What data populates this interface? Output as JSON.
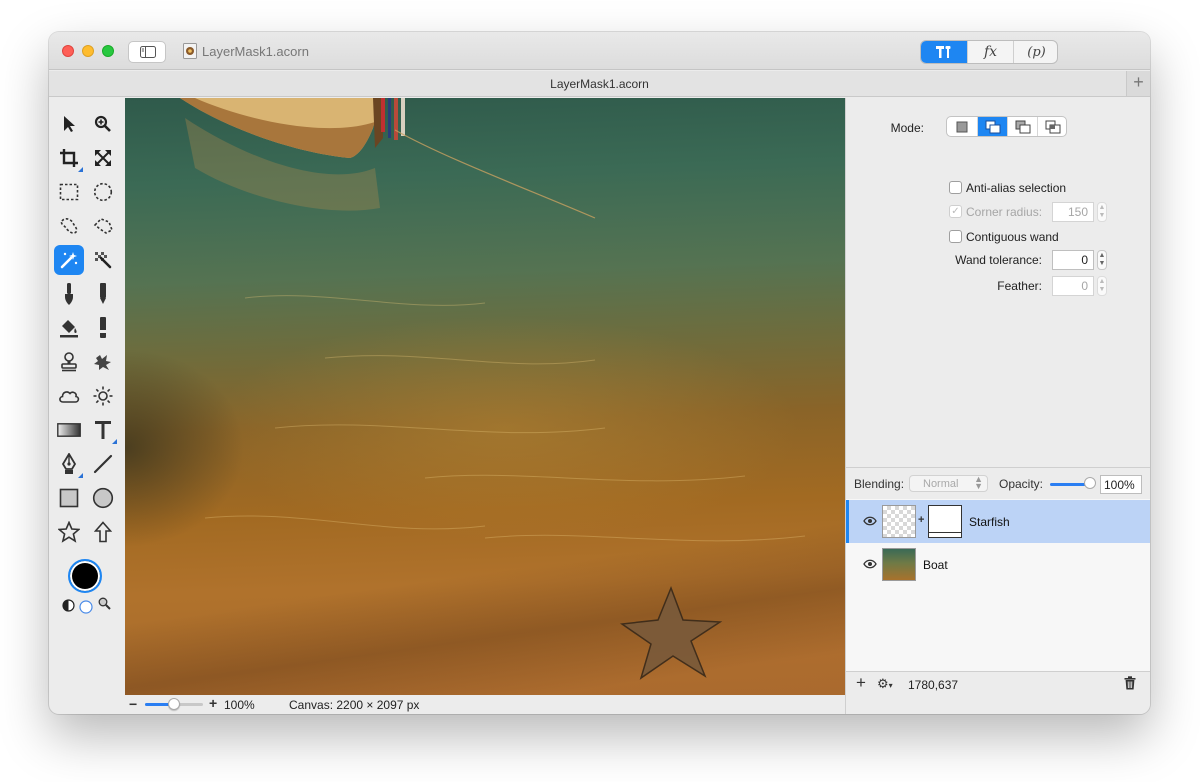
{
  "window": {
    "title": "LayerMask1.acorn",
    "tab_title": "LayerMask1.acorn",
    "tab_add_label": "+"
  },
  "toolbar": {
    "segments": [
      {
        "icon": "tools-icon",
        "selected": true
      },
      {
        "icon": "fx-icon",
        "label": "fx",
        "selected": false
      },
      {
        "icon": "p-icon",
        "label": "(p)",
        "selected": false
      }
    ]
  },
  "tools": [
    {
      "name": "select-arrow-icon"
    },
    {
      "name": "zoom-icon"
    },
    {
      "name": "crop-icon"
    },
    {
      "name": "resize-icon"
    },
    {
      "name": "rect-select-icon"
    },
    {
      "name": "ellipse-select-icon"
    },
    {
      "name": "lasso-icon"
    },
    {
      "name": "polygon-lasso-icon"
    },
    {
      "name": "magic-wand-icon",
      "active": true
    },
    {
      "name": "magic-eraser-icon"
    },
    {
      "name": "brush-icon"
    },
    {
      "name": "pencil-icon"
    },
    {
      "name": "paint-bucket-icon"
    },
    {
      "name": "eraser-icon"
    },
    {
      "name": "stamp-icon"
    },
    {
      "name": "smudge-icon"
    },
    {
      "name": "cloud-icon"
    },
    {
      "name": "sun-icon"
    },
    {
      "name": "gradient-icon"
    },
    {
      "name": "text-icon"
    },
    {
      "name": "pen-icon"
    },
    {
      "name": "line-icon"
    },
    {
      "name": "rectangle-icon"
    },
    {
      "name": "circle-icon"
    },
    {
      "name": "star-icon"
    },
    {
      "name": "arrow-up-icon"
    }
  ],
  "colors": {
    "foreground": "#000000",
    "background": "#ffffff",
    "accent": "#1e86f2"
  },
  "inspector": {
    "mode_label": "Mode:",
    "mode_selected_index": 1,
    "anti_alias": {
      "label": "Anti-alias selection",
      "checked": false
    },
    "corner_radius": {
      "label": "Corner radius:",
      "value": "150",
      "enabled": false,
      "checked": true
    },
    "contiguous_wand": {
      "label": "Contiguous wand",
      "checked": false
    },
    "wand_tolerance": {
      "label": "Wand tolerance:",
      "value": "0"
    },
    "feather": {
      "label": "Feather:",
      "value": "0",
      "enabled": false
    }
  },
  "layers_panel": {
    "blending_label": "Blending:",
    "blending_value": "Normal",
    "opacity_label": "Opacity:",
    "opacity_value": "100%",
    "opacity_fraction": 1.0,
    "layers": [
      {
        "name": "Starfish",
        "selected": true,
        "visible": true,
        "has_mask": true
      },
      {
        "name": "Boat",
        "selected": false,
        "visible": true,
        "has_mask": false
      }
    ],
    "footer_add": "+",
    "coordinates": "1780,637"
  },
  "status": {
    "zoom_minus": "−",
    "zoom_plus": "+",
    "zoom_value": "100%",
    "zoom_fraction": 0.5,
    "canvas_size": "Canvas: 2200 × 2097 px"
  }
}
